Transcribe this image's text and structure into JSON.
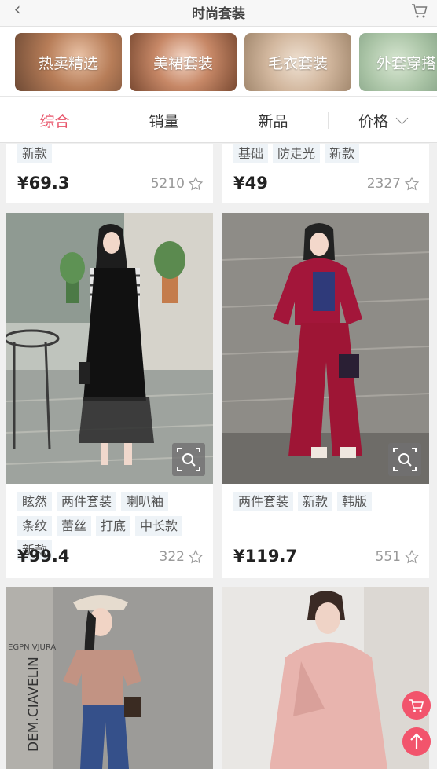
{
  "header": {
    "title": "时尚套装",
    "back_icon": "chevron-left-icon",
    "cart_icon": "cart-icon"
  },
  "categories": [
    {
      "label": "热卖精选"
    },
    {
      "label": "美裙套装"
    },
    {
      "label": "毛衣套装"
    },
    {
      "label": "外套穿搭"
    }
  ],
  "sort_tabs": [
    {
      "label": "综合",
      "active": true
    },
    {
      "label": "销量"
    },
    {
      "label": "新品"
    },
    {
      "label": "价格"
    }
  ],
  "colors": {
    "accent": "#e8546a",
    "tag_bg": "#eef3f7"
  },
  "products": [
    {
      "tags": [
        "新款"
      ],
      "price": "¥69.3",
      "count": "5210"
    },
    {
      "tags": [
        "基础",
        "防走光",
        "新款"
      ],
      "price": "¥49",
      "count": "2327"
    },
    {
      "tags": [
        "眩然",
        "两件套装",
        "喇叭袖",
        "条纹",
        "蕾丝",
        "打底",
        "中长款",
        "新款"
      ],
      "price": "¥99.4",
      "count": "322"
    },
    {
      "tags": [
        "两件套装",
        "新款",
        "韩版"
      ],
      "price": "¥119.7",
      "count": "551"
    },
    {
      "tags": [],
      "price": "",
      "count": ""
    },
    {
      "tags": [],
      "price": "",
      "count": ""
    }
  ],
  "photo_text": {
    "text_a": "DEM.CIAVELIN",
    "text_b": "EGPN VJURA"
  }
}
